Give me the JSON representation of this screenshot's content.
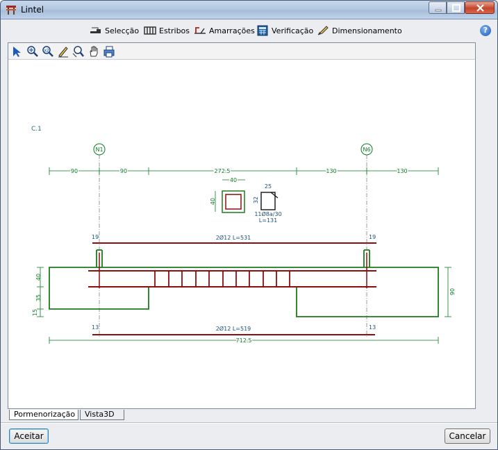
{
  "window": {
    "title": "Lintel"
  },
  "menu": {
    "selection": "Selecção",
    "stirrups": "Estribos",
    "ties": "Amarrações",
    "verification": "Verificação",
    "design": "Dimensionamento"
  },
  "drawing": {
    "element_label": "C.1",
    "node_left": "N1",
    "node_right": "N6",
    "dims_top": [
      "90",
      "90",
      "272.5",
      "130",
      "130"
    ],
    "section_width": "40",
    "section_height": "40",
    "stirrup_top": "25",
    "stirrup_side": "32",
    "stirrup_label": "11Ø8a/30",
    "stirrup_length": "L=131",
    "top_bar_label": "2Ø12 L=531",
    "top_hook_left": "19",
    "top_hook_right": "19",
    "bottom_bar_label": "2Ø12 L=519",
    "bottom_hook_left": "13",
    "bottom_hook_right": "13",
    "total_dim": "712.5",
    "left_dims": [
      "40",
      "35",
      "15"
    ],
    "right_dim": "90"
  },
  "colors": {
    "dimension": "#0a7a20",
    "bar": "#8b0d0d",
    "beam": "#1c7a1c",
    "label": "#1a4f7a"
  },
  "tabs": {
    "detailing": "Pormenorização",
    "view3d": "Vista3D"
  },
  "buttons": {
    "accept": "Aceitar",
    "cancel": "Cancelar"
  }
}
